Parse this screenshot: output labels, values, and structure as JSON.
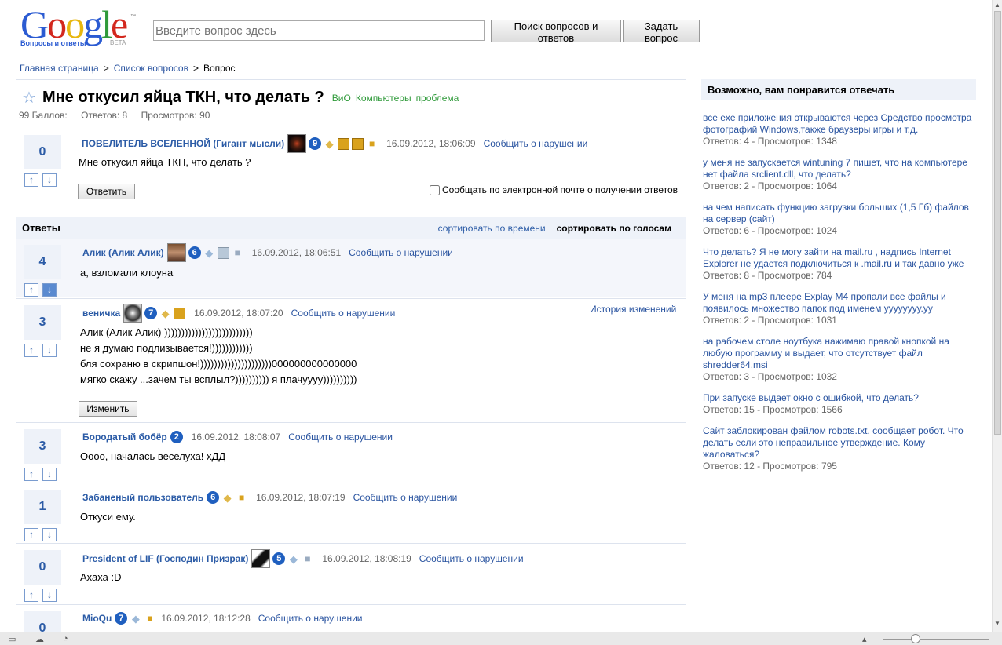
{
  "header": {
    "logo_text": "Google",
    "logo_subtitle": "Вопросы и ответы",
    "logo_beta": "BETA",
    "search_placeholder": "Введите вопрос здесь",
    "search_button": "Поиск вопросов и ответов",
    "ask_button": "Задать вопрос"
  },
  "breadcrumb": [
    "Главная страница",
    "Список вопросов",
    "Вопрос"
  ],
  "question": {
    "title": "Мне откусил яйца ТКН, что делать ?",
    "tags": [
      "ВиО",
      "Компьютеры",
      "проблема"
    ],
    "points": "99 Баллов:",
    "answers": "Ответов: 8",
    "views": "Просмотров: 90",
    "votes": "0",
    "author": "ПОВЕЛИТЕЛЬ ВСЕЛЕННОЙ (Гигант мысли)",
    "level": "9",
    "date": "16.09.2012, 18:06:09",
    "report": "Сообщить о нарушении",
    "body": "Мне откусил яйца ТКН, что делать ?",
    "reply_button": "Ответить",
    "email_notify": "Сообщать по электронной почте о получении ответов"
  },
  "answers_header": {
    "title": "Ответы",
    "sort_time": "сортировать по времени",
    "sort_votes": "сортировать по голосам"
  },
  "answers": [
    {
      "votes": "4",
      "author": "Алик (Алик Алик)",
      "level": "6",
      "date": "16.09.2012, 18:06:51",
      "report": "Сообщить о нарушении",
      "body": "а, взломали клоуна"
    },
    {
      "votes": "3",
      "author": "веничка",
      "level": "7",
      "date": "16.09.2012, 18:07:20",
      "report": "Сообщить о нарушении",
      "history": "История изменений",
      "body": "Алик (Алик Алик) ))))))))))))))))))))))))))\nне я думаю подлизывается!))))))))))))\nбля сохраню в скрипшон!)))))))))))))))))))))000000000000000\nмягко скажу ...зачем ты всплыл?)))))))))) я плачуууу))))))))))",
      "edit_button": "Изменить"
    },
    {
      "votes": "3",
      "author": "Бородатый бобёр",
      "level": "2",
      "date": "16.09.2012, 18:08:07",
      "report": "Сообщить о нарушении",
      "body": "Оооо, началась веселуха! хДД"
    },
    {
      "votes": "1",
      "author": "Забаненый пользователь",
      "level": "6",
      "date": "16.09.2012, 18:07:19",
      "report": "Сообщить о нарушении",
      "body": "Откуси ему."
    },
    {
      "votes": "0",
      "author": "President of LIF (Господин Призрак)",
      "level": "5",
      "date": "16.09.2012, 18:08:19",
      "report": "Сообщить о нарушении",
      "body": "Ахаха :D"
    },
    {
      "votes": "0",
      "author": "MioQu",
      "level": "7",
      "date": "16.09.2012, 18:12:28",
      "report": "Сообщить о нарушении"
    }
  ],
  "sidebar": {
    "title": "Возможно, вам понравится отвечать",
    "items": [
      {
        "q": "все exe приложения открываются через Средство просмотра фотографий Windows,также браузеры игры и т.д.",
        "meta": "Ответов: 4  -  Просмотров: 1348"
      },
      {
        "q": "у меня не запускается wintuning 7 пишет, что на компьютере нет файла srclient.dll, что делать?",
        "meta": "Ответов: 2  -  Просмотров: 1064"
      },
      {
        "q": "на чем написать функцию загрузки больших (1,5 Гб) файлов на сервер (сайт)",
        "meta": "Ответов: 6  -  Просмотров: 1024"
      },
      {
        "q": "Что делать? Я не могу зайти на mail.ru , надпись Internet Explorer не удается подключиться к .mail.ru и так давно уже",
        "meta": "Ответов: 8  -  Просмотров: 784"
      },
      {
        "q": "У меня на mp3 плеере Explay M4 пропали все файлы и появилось множество папок под именем уууууууу.уу",
        "meta": "Ответов: 2  -  Просмотров: 1031"
      },
      {
        "q": "на рабочем столе ноутбука нажимаю правой кнопкой на любую программу и выдает, что отсутствует файл shredder64.msi",
        "meta": "Ответов: 3  -  Просмотров: 1032"
      },
      {
        "q": "При запуске выдает окно с ошибкой, что делать?",
        "meta": "Ответов: 15  -  Просмотров: 1566"
      },
      {
        "q": "Сайт заблокирован файлом robots.txt, сообщает робот. Что делать если это неправильное утверждение. Кому жаловаться?",
        "meta": "Ответов: 12  -  Просмотров: 795"
      }
    ]
  },
  "colors": {
    "link": "#2a54a0",
    "tag": "#2f9a3a",
    "panel": "#eef2f9",
    "level_badge": "#1f5fbf"
  }
}
